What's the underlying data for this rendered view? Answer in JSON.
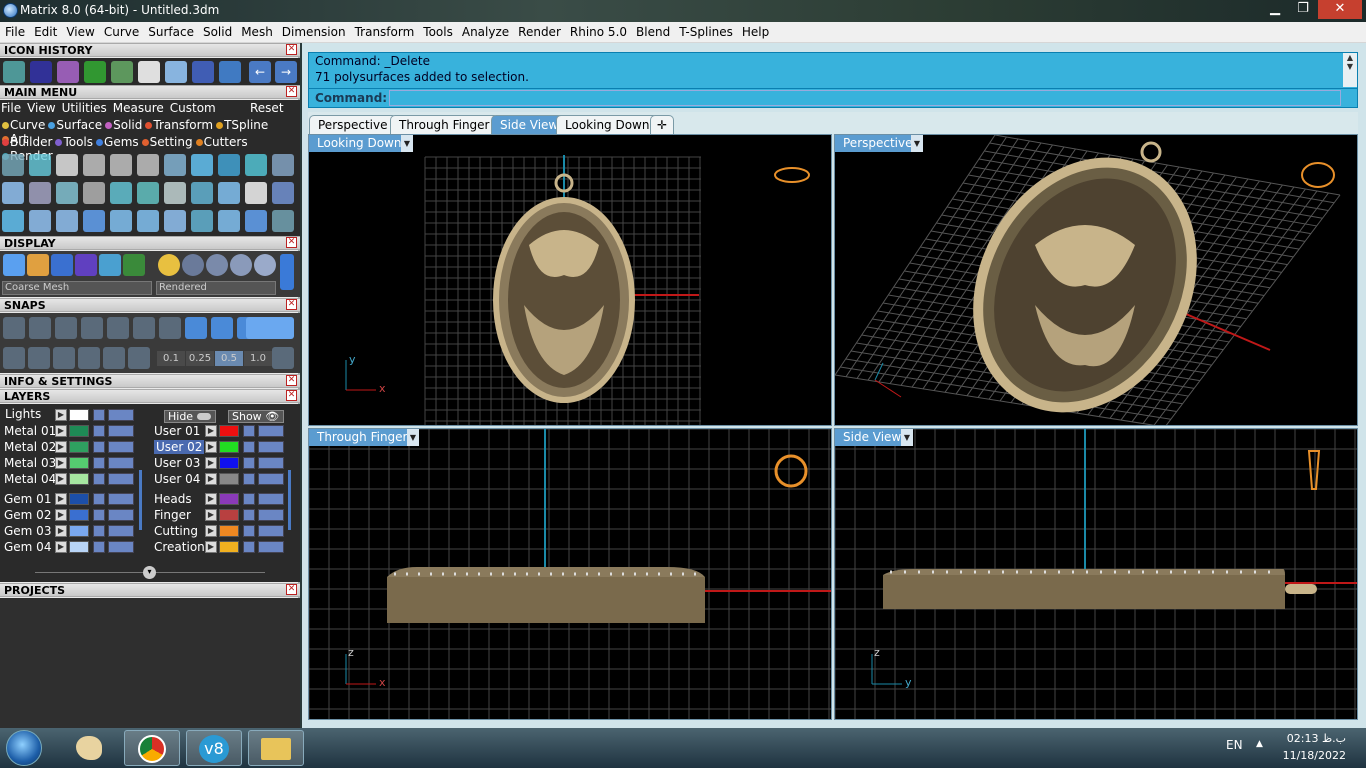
{
  "window": {
    "title": "Matrix 8.0 (64-bit) - Untitled.3dm",
    "min": "▁",
    "max": "❐",
    "close": "✕"
  },
  "menubar": [
    "File",
    "Edit",
    "View",
    "Curve",
    "Surface",
    "Solid",
    "Mesh",
    "Dimension",
    "Transform",
    "Tools",
    "Analyze",
    "Render",
    "Rhino 5.0",
    "Blend",
    "T-Splines",
    "Help"
  ],
  "panel": {
    "icon_history": "ICON HISTORY",
    "main_menu": "MAIN MENU",
    "main_menu_items": [
      "File",
      "View",
      "Utilities",
      "Measure",
      "Custom"
    ],
    "reset": "Reset",
    "row1": [
      {
        "label": "Curve",
        "color": "#e0c040"
      },
      {
        "label": "Surface",
        "color": "#4aa0e0"
      },
      {
        "label": "Solid",
        "color": "#c060c0"
      },
      {
        "label": "Transform",
        "color": "#e05030"
      },
      {
        "label": "TSpline",
        "color": "#e0a020"
      },
      {
        "label": "Art",
        "color": "#e07030"
      }
    ],
    "row2": [
      {
        "label": "Builder",
        "color": "#e04040"
      },
      {
        "label": "Tools",
        "color": "#8060d0"
      },
      {
        "label": "Gems",
        "color": "#4080e0"
      },
      {
        "label": "Setting",
        "color": "#e06030"
      },
      {
        "label": "Cutters",
        "color": "#e08020"
      },
      {
        "label": "Render",
        "color": "#40a0b0"
      }
    ],
    "display": "DISPLAY",
    "display_mode": "Coarse Mesh",
    "render_mode": "Rendered",
    "snaps": "SNAPS",
    "snap_values": [
      "0.1",
      "0.25",
      "0.5",
      "1.0"
    ],
    "info": "INFO & SETTINGS",
    "layers": "LAYERS",
    "lights": "Lights",
    "hide": "Hide",
    "show": "Show",
    "projects": "PROJECTS"
  },
  "layers_left": [
    {
      "name": "Metal 01",
      "color": "#1e8a55"
    },
    {
      "name": "Metal 02",
      "color": "#2fa060"
    },
    {
      "name": "Metal 03",
      "color": "#55cc70"
    },
    {
      "name": "Metal 04",
      "color": "#a6e6a0"
    },
    {
      "name": "Gem 01",
      "color": "#1c4fa8"
    },
    {
      "name": "Gem 02",
      "color": "#3a6fd0"
    },
    {
      "name": "Gem 03",
      "color": "#7aa8ee"
    },
    {
      "name": "Gem 04",
      "color": "#b8d4f6"
    }
  ],
  "layers_right": [
    {
      "name": "User 01",
      "color": "#ee1010"
    },
    {
      "name": "User 02",
      "color": "#22dd22"
    },
    {
      "name": "User 03",
      "color": "#1010ee"
    },
    {
      "name": "User 04",
      "color": "#888888"
    },
    {
      "name": "Heads",
      "color": "#8a3ab8"
    },
    {
      "name": "Finger",
      "color": "#b84040"
    },
    {
      "name": "Cutting",
      "color": "#ee8822"
    },
    {
      "name": "Creation",
      "color": "#f0b020"
    }
  ],
  "command": {
    "line1": "Command: _Delete",
    "line2": "71 polysurfaces added to selection.",
    "prompt": "Command:"
  },
  "tabs": [
    "Perspective",
    "Through Finger",
    "Side View",
    "Looking Down"
  ],
  "tab_add": "✛",
  "active_tab": "Side View",
  "viewports": [
    {
      "label": "Looking Down"
    },
    {
      "label": "Perspective"
    },
    {
      "label": "Through Finger"
    },
    {
      "label": "Side View"
    }
  ],
  "axes": {
    "x": "x",
    "y": "y",
    "z": "z"
  },
  "taskbar": {
    "lang": "EN",
    "time": "02:13 ب.ظ",
    "date": "11/18/2022"
  }
}
